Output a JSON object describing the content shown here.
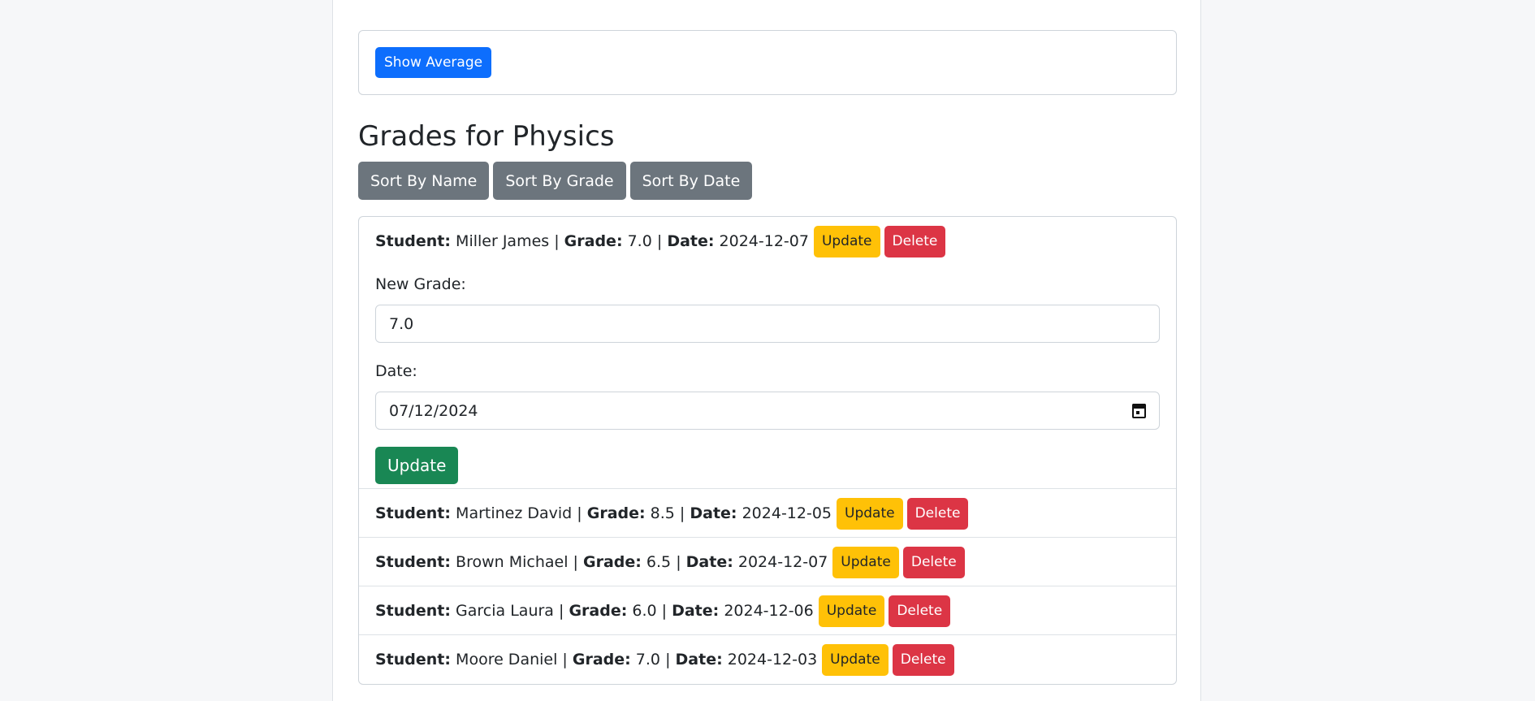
{
  "average": {
    "button_label": "Show Average"
  },
  "heading": "Grades for Physics",
  "sort": {
    "by_name": "Sort By Name",
    "by_grade": "Sort By Grade",
    "by_date": "Sort By Date"
  },
  "labels": {
    "student": "Student:",
    "grade": "Grade:",
    "date": "Date:",
    "sep": "|",
    "update": "Update",
    "delete": "Delete"
  },
  "edit_form": {
    "new_grade_label": "New Grade:",
    "new_grade_value": "7.0",
    "date_label": "Date:",
    "date_value": "07/12/2024",
    "submit_label": "Update"
  },
  "grades": [
    {
      "student": "Miller James",
      "grade": "7.0",
      "date": "2024-12-07"
    },
    {
      "student": "Martinez David",
      "grade": "8.5",
      "date": "2024-12-05"
    },
    {
      "student": "Brown Michael",
      "grade": "6.5",
      "date": "2024-12-07"
    },
    {
      "student": "Garcia Laura",
      "grade": "6.0",
      "date": "2024-12-06"
    },
    {
      "student": "Moore Daniel",
      "grade": "7.0",
      "date": "2024-12-03"
    }
  ]
}
